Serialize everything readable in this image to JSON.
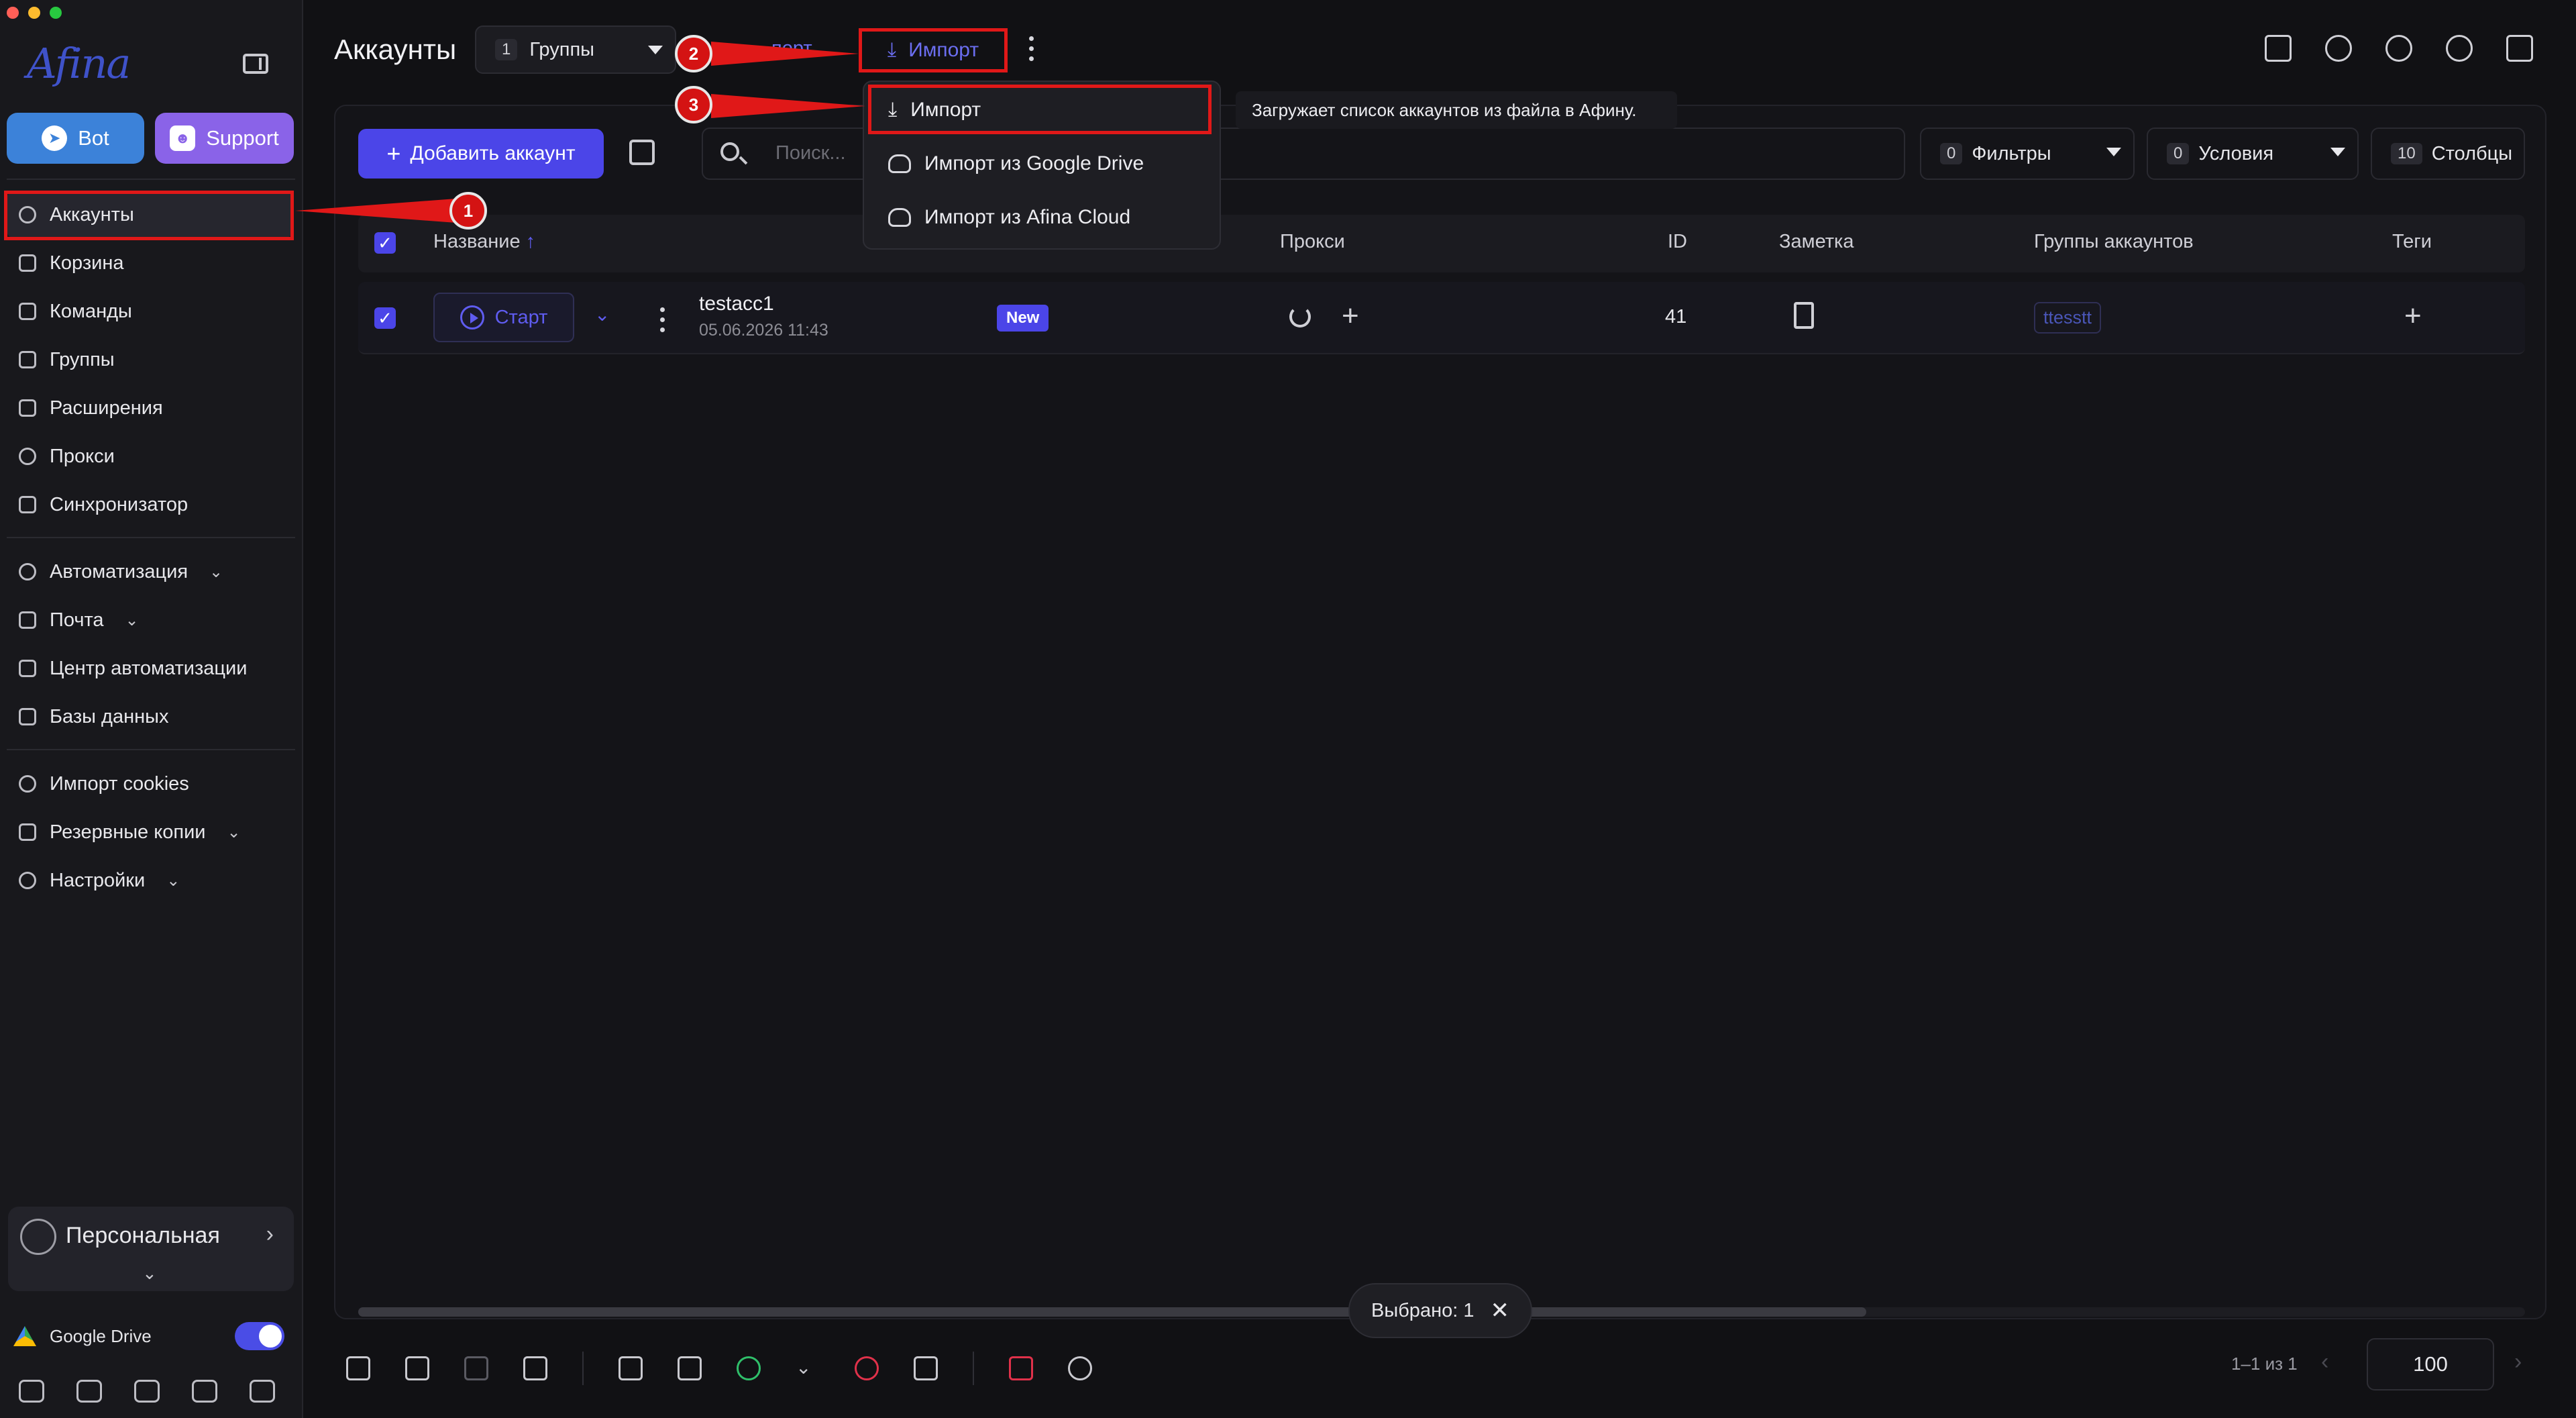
{
  "app": {
    "logo_text": "Afina"
  },
  "sidebar": {
    "bot_label": "Bot",
    "support_label": "Support",
    "items": [
      {
        "label": "Аккаунты",
        "icon": "user-circle-icon"
      },
      {
        "label": "Корзина",
        "icon": "trash-icon"
      },
      {
        "label": "Команды",
        "icon": "team-icon"
      },
      {
        "label": "Группы",
        "icon": "users-icon"
      },
      {
        "label": "Расширения",
        "icon": "puzzle-icon"
      },
      {
        "label": "Прокси",
        "icon": "cloud-icon"
      },
      {
        "label": "Синхронизатор",
        "icon": "sync-icon"
      }
    ],
    "items2": [
      {
        "label": "Автоматизация",
        "icon": "automation-icon"
      },
      {
        "label": "Почта",
        "icon": "mail-icon"
      },
      {
        "label": "Центр автоматизации",
        "icon": "laptop-icon"
      },
      {
        "label": "Базы данных",
        "icon": "list-icon"
      }
    ],
    "items3": [
      {
        "label": "Импорт cookies",
        "icon": "cookie-icon"
      },
      {
        "label": "Резервные копии",
        "icon": "backup-icon"
      },
      {
        "label": "Настройки",
        "icon": "gear-icon"
      }
    ],
    "profile_name": "Персональная",
    "gdrive_label": "Google Drive"
  },
  "header": {
    "title": "Аккаунты",
    "groups_count": "1",
    "groups_label": "Группы",
    "export_label": "порт",
    "import_label": "Импорт"
  },
  "toolbar": {
    "add_account": "Добавить аккаунт",
    "search_placeholder": "Поиск...",
    "filters_count": "0",
    "filters_label": "Фильтры",
    "conditions_count": "0",
    "conditions_label": "Условия",
    "columns_count": "10",
    "columns_label": "Столбцы"
  },
  "table": {
    "headers": {
      "name": "Название",
      "proxy": "Прокси",
      "id": "ID",
      "note": "Заметка",
      "groups": "Группы аккаунтов",
      "tags": "Теги"
    },
    "rows": [
      {
        "start_label": "Старт",
        "name": "testacc1",
        "date": "05.06.2026 11:43",
        "status": "New",
        "id": "41",
        "group": "ttesstt"
      }
    ]
  },
  "selection": {
    "label": "Выбрано: 1"
  },
  "pager": {
    "range": "1–1 из 1",
    "page_size": "100"
  },
  "dropdown": {
    "items": [
      {
        "label": "Импорт",
        "icon": "download-icon"
      },
      {
        "label": "Импорт из Google Drive",
        "icon": "cloud-download-icon"
      },
      {
        "label": "Импорт из Afina Cloud",
        "icon": "cloud-download-icon"
      }
    ],
    "tooltip": "Загружает список аккаунтов из файла в Афину."
  },
  "annotations": {
    "m1": "1",
    "m2": "2",
    "m3": "3"
  },
  "colors": {
    "accent": "#4b45e8",
    "annotation_red": "#e01818",
    "telegram_blue": "#3c82d9",
    "discord_purple": "#8a63e8",
    "toggle_on": "#4a4de6"
  }
}
